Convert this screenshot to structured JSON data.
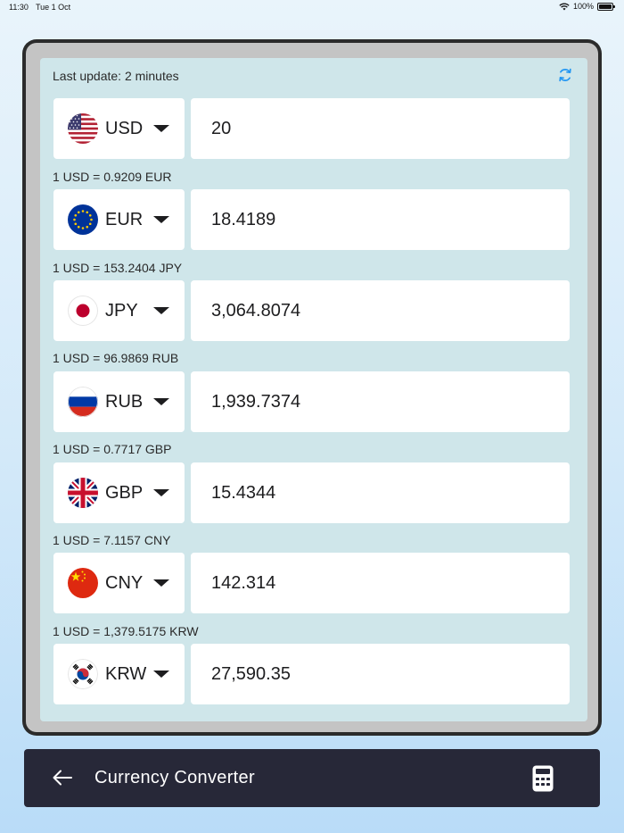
{
  "status": {
    "time": "11:30",
    "date": "Tue 1 Oct",
    "battery": "100%"
  },
  "panel": {
    "last_update": "Last update: 2 minutes"
  },
  "currencies": [
    {
      "code": "USD",
      "amount": "20",
      "rate": "1 USD = 0.9209 EUR"
    },
    {
      "code": "EUR",
      "amount": "18.4189",
      "rate": "1 USD = 153.2404 JPY"
    },
    {
      "code": "JPY",
      "amount": "3,064.8074",
      "rate": "1 USD = 96.9869 RUB"
    },
    {
      "code": "RUB",
      "amount": "1,939.7374",
      "rate": "1 USD = 0.7717 GBP"
    },
    {
      "code": "GBP",
      "amount": "15.4344",
      "rate": "1 USD = 7.1157 CNY"
    },
    {
      "code": "CNY",
      "amount": "142.314",
      "rate": "1 USD = 1,379.5175 KRW"
    },
    {
      "code": "KRW",
      "amount": "27,590.35"
    }
  ],
  "bottom_bar": {
    "title": "Currency Converter"
  },
  "icons": {
    "back": "arrow-left-icon",
    "calculator": "calculator-icon",
    "refresh": "refresh-icon"
  },
  "colors": {
    "accent": "#2196f3",
    "panel_bg": "#cfe6ea",
    "bar_bg": "#272838"
  }
}
